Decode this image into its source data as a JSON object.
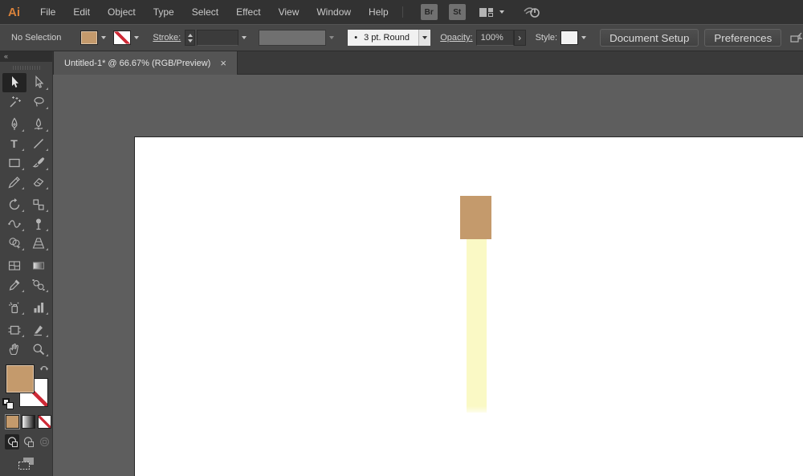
{
  "app": {
    "logo_text": "Ai"
  },
  "menubar": {
    "items": [
      "File",
      "Edit",
      "Object",
      "Type",
      "Select",
      "Effect",
      "View",
      "Window",
      "Help"
    ],
    "br_button": "Br",
    "st_button": "St"
  },
  "controlbar": {
    "selection_status": "No Selection",
    "stroke_label": "Stroke:",
    "brush_bullet": "•",
    "brush_value": "3 pt. Round",
    "opacity_label": "Opacity:",
    "opacity_value": "100%",
    "opacity_popup_glyph": "›",
    "style_label": "Style:",
    "document_setup_button": "Document Setup",
    "preferences_button": "Preferences"
  },
  "tabbar": {
    "active_tab_title": "Untitled-1* @ 66.67% (RGB/Preview)",
    "close_glyph": "×"
  },
  "toolbar": {
    "collapse_glyph": "«",
    "type_tool_glyph": "T",
    "tools": [
      "selection",
      "direct-selection",
      "magic-wand",
      "lasso",
      "pen",
      "curvature",
      "type",
      "line-segment",
      "rectangle",
      "paintbrush",
      "shaper",
      "eraser",
      "rotate",
      "scale",
      "width",
      "puppet-warp",
      "shape-builder",
      "perspective-grid",
      "mesh",
      "gradient",
      "eyedropper",
      "blend",
      "symbol-sprayer",
      "column-graph",
      "artboard",
      "slice",
      "hand",
      "zoom"
    ]
  },
  "colors": {
    "fill_swatch": "#C49A6C",
    "shape_tan": "#C49A6C",
    "shape_yellow": "#FAF9C5",
    "stroke_none_red": "#CE2A36"
  },
  "canvas": {
    "shapes": [
      {
        "name": "tan-rectangle",
        "color": "#C49A6C"
      },
      {
        "name": "pale-yellow-rectangle",
        "color": "#FAF9C5"
      }
    ]
  }
}
